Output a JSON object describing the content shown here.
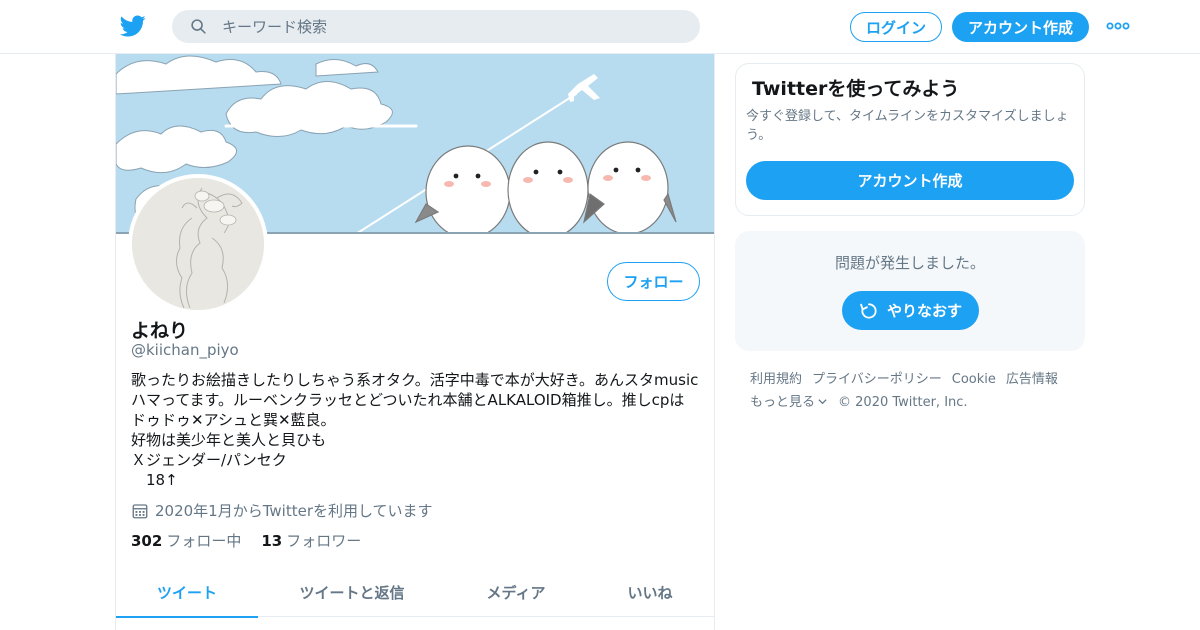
{
  "header": {
    "search_placeholder": "キーワード検索",
    "login_label": "ログイン",
    "signup_label": "アカウント作成"
  },
  "profile": {
    "display_name": "よねり",
    "handle": "@kiichan_piyo",
    "follow_label": "フォロー",
    "bio_lines": [
      "歌ったりお絵描きしたりしちゃう系オタク。活字中毒で本が大好き。あんスタmusic",
      "ハマってます。ルーベンクラッセとどついたれ本舗とALKALOID箱推し。推しcpは",
      "ドゥドゥ✕アシュと巽✕藍良。",
      "好物は美少年と美人と貝ひも",
      "Ｘジェンダー/パンセク",
      "　18↑"
    ],
    "joined": "2020年1月からTwitterを利用しています",
    "following_count": "302",
    "following_label": "フォロー中",
    "followers_count": "13",
    "followers_label": "フォロワー"
  },
  "tabs": [
    {
      "label": "ツイート",
      "active": true
    },
    {
      "label": "ツイートと返信",
      "active": false
    },
    {
      "label": "メディア",
      "active": false
    },
    {
      "label": "いいね",
      "active": false
    }
  ],
  "signup_card": {
    "title": "Twitterを使ってみよう",
    "description": "今すぐ登録して、タイムラインをカスタマイズしましょう。",
    "button_label": "アカウント作成"
  },
  "error_box": {
    "message": "問題が発生しました。",
    "retry_label": "やりなおす"
  },
  "footer": {
    "terms": "利用規約",
    "privacy": "プライバシーポリシー",
    "cookie": "Cookie",
    "ads": "広告情報",
    "more": "もっと見る",
    "copyright": "© 2020 Twitter, Inc."
  },
  "colors": {
    "accent": "#1da1f2",
    "secondary_text": "#657786",
    "border": "#e6ecf0",
    "banner_sky": "#b7dcef"
  }
}
